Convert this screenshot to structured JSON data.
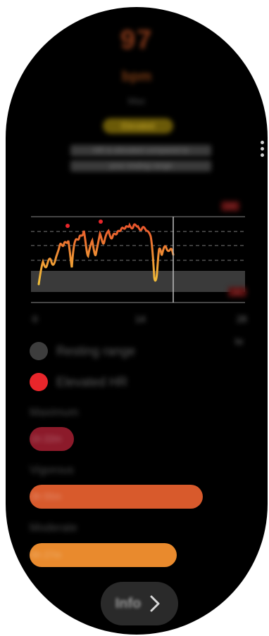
{
  "header": {
    "heart_rate_value": "97",
    "heart_rate_unit": "bpm",
    "subtitle": "Max",
    "status": "Elevated",
    "description_line1": "HR is elevated compared to",
    "description_line2": "your resting range"
  },
  "chart": {
    "top_badge": "140",
    "bottom_badge": "60",
    "x_ticks": [
      "0",
      "14",
      "28"
    ],
    "x_tick_secondary": "hr"
  },
  "legend": {
    "items": [
      {
        "label": "Resting range",
        "color": "#3d3d3d"
      },
      {
        "label": "Elevated HR",
        "color": "#e8262b"
      }
    ]
  },
  "zones": [
    {
      "label": "Maximum",
      "time": "1h 22m",
      "color": "#8c1a2a",
      "fraction": 0.2
    },
    {
      "label": "Vigorous",
      "time": "3h 55m",
      "color": "#d85a2c",
      "fraction": 0.78
    },
    {
      "label": "Moderate",
      "time": "6h 27m",
      "color": "#e98a2d",
      "fraction": 0.66
    }
  ],
  "info_button": {
    "label": "Info"
  },
  "colors": {
    "background": "#000000",
    "line_gradient_start": "#f2b93a",
    "line_gradient_end": "#e9542c"
  }
}
